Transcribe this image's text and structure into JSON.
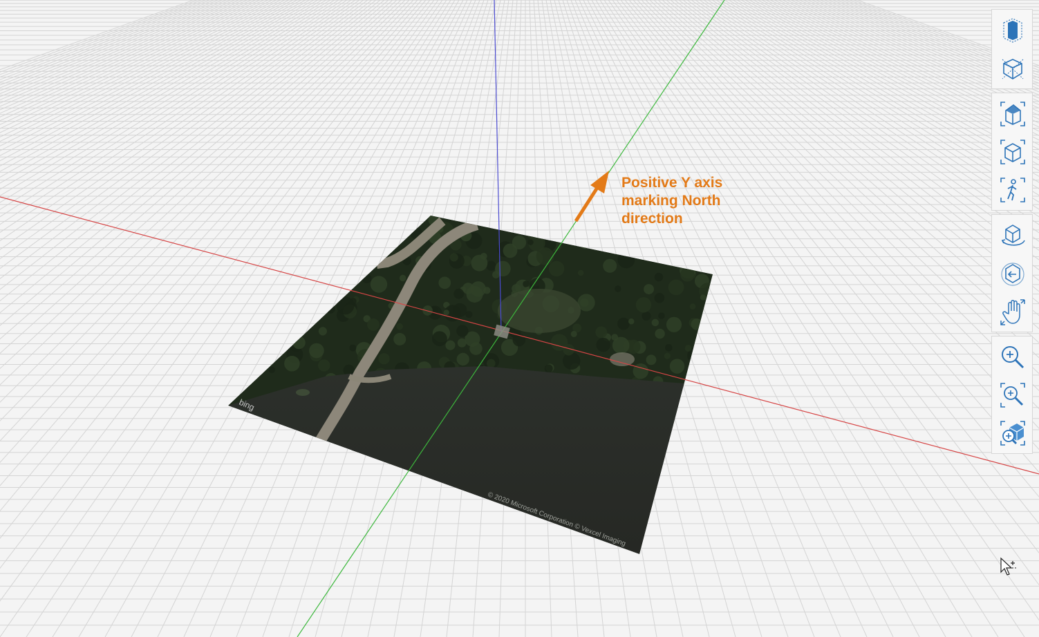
{
  "annotation": {
    "lines": [
      "Positive Y axis",
      "marking North",
      "direction"
    ],
    "color": "#e37a17"
  },
  "map": {
    "provider": "bing",
    "copyright": "© 2020 Microsoft Corporation © Vexcel Imaging"
  },
  "axes": {
    "x_color": "#d64545",
    "y_color": "#3db83d",
    "z_color": "#4a4ad0"
  },
  "toolbar": {
    "groups": [
      [
        {
          "name": "section-box-icon",
          "label": "Section box"
        },
        {
          "name": "section-cut-icon",
          "label": "Section plane"
        }
      ],
      [
        {
          "name": "home-view-icon",
          "label": "Home view"
        },
        {
          "name": "view-cube-icon",
          "label": "Views"
        },
        {
          "name": "walk-icon",
          "label": "Walk"
        }
      ],
      [
        {
          "name": "orbit-icon",
          "label": "Orbit"
        },
        {
          "name": "free-orbit-icon",
          "label": "Free orbit"
        },
        {
          "name": "pan-icon",
          "label": "Pan"
        }
      ],
      [
        {
          "name": "zoom-icon",
          "label": "Zoom"
        },
        {
          "name": "zoom-window-icon",
          "label": "Zoom window"
        },
        {
          "name": "zoom-extents-icon",
          "label": "Zoom extents"
        }
      ]
    ],
    "accent_color": "#2c73b8"
  }
}
